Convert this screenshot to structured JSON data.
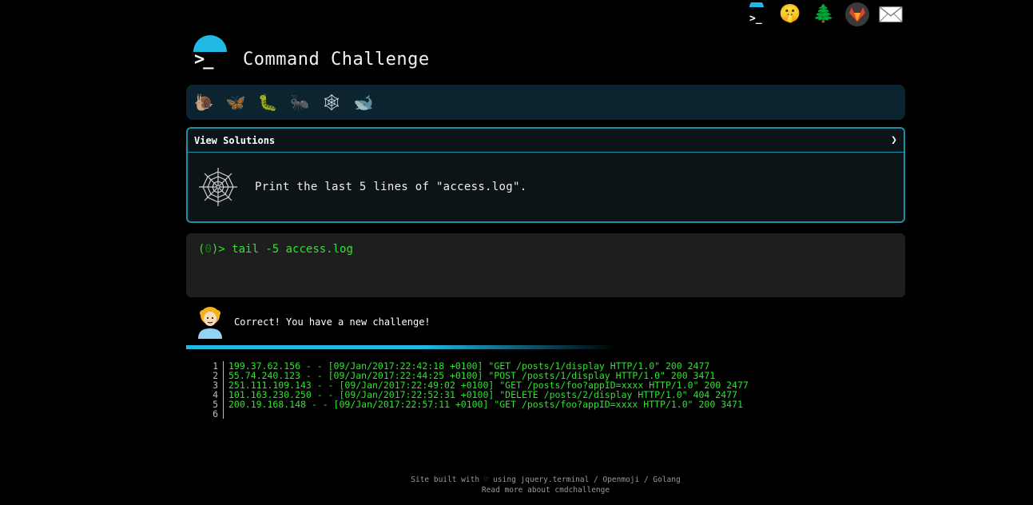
{
  "topbar": {
    "icons": [
      {
        "name": "terminal-logo-icon"
      },
      {
        "name": "shush-face-icon",
        "glyph": "🤫"
      },
      {
        "name": "tree-icon",
        "glyph": "🌲"
      },
      {
        "name": "gitlab-icon"
      },
      {
        "name": "mail-icon",
        "glyph": "✉"
      }
    ]
  },
  "header": {
    "title": "Command Challenge",
    "logo_prompt": ">_"
  },
  "levels": [
    {
      "name": "snail-icon",
      "glyph": "🐌"
    },
    {
      "name": "butterfly-icon",
      "glyph": "🦋"
    },
    {
      "name": "caterpillar-icon",
      "glyph": "🐛"
    },
    {
      "name": "ant-icon",
      "glyph": "🐜"
    },
    {
      "name": "spider-web-icon",
      "glyph": "🕸"
    },
    {
      "name": "whale-icon",
      "glyph": "🐋"
    }
  ],
  "challenge": {
    "solutions_label": "View Solutions",
    "chevron": "❯",
    "task": "Print the last 5 lines of \"access.log\"."
  },
  "terminal": {
    "prompt_open": "(",
    "prompt_status": "0",
    "prompt_close": ")>",
    "command": "tail -5 access.log"
  },
  "result": {
    "message": "Correct! You have a new challenge!"
  },
  "output": {
    "lines": [
      {
        "n": "1",
        "text": "199.37.62.156 - - [09/Jan/2017:22:42:18 +0100] \"GET /posts/1/display HTTP/1.0\" 200 2477"
      },
      {
        "n": "2",
        "text": "55.74.240.123 - - [09/Jan/2017:22:44:25 +0100] \"POST /posts/1/display HTTP/1.0\" 200 3471"
      },
      {
        "n": "3",
        "text": "251.111.109.143 - - [09/Jan/2017:22:49:02 +0100] \"GET /posts/foo?appID=xxxx HTTP/1.0\" 200 2477"
      },
      {
        "n": "4",
        "text": "101.163.230.250 - - [09/Jan/2017:22:52:31 +0100] \"DELETE /posts/2/display HTTP/1.0\" 404 2477"
      },
      {
        "n": "5",
        "text": "200.19.168.148 - - [09/Jan/2017:22:57:11 +0100] \"GET /posts/foo?appID=xxxx HTTP/1.0\" 200 3471"
      },
      {
        "n": "6",
        "text": ""
      }
    ]
  },
  "footer": {
    "line1": "Site built with ♡ using jquery.terminal / Openmoji / Golang",
    "line2": "Read more about cmdchallenge"
  },
  "colors": {
    "accent": "#22b8e6",
    "terminal_green": "#2ee52e",
    "panel_border": "#1f8fa8"
  }
}
